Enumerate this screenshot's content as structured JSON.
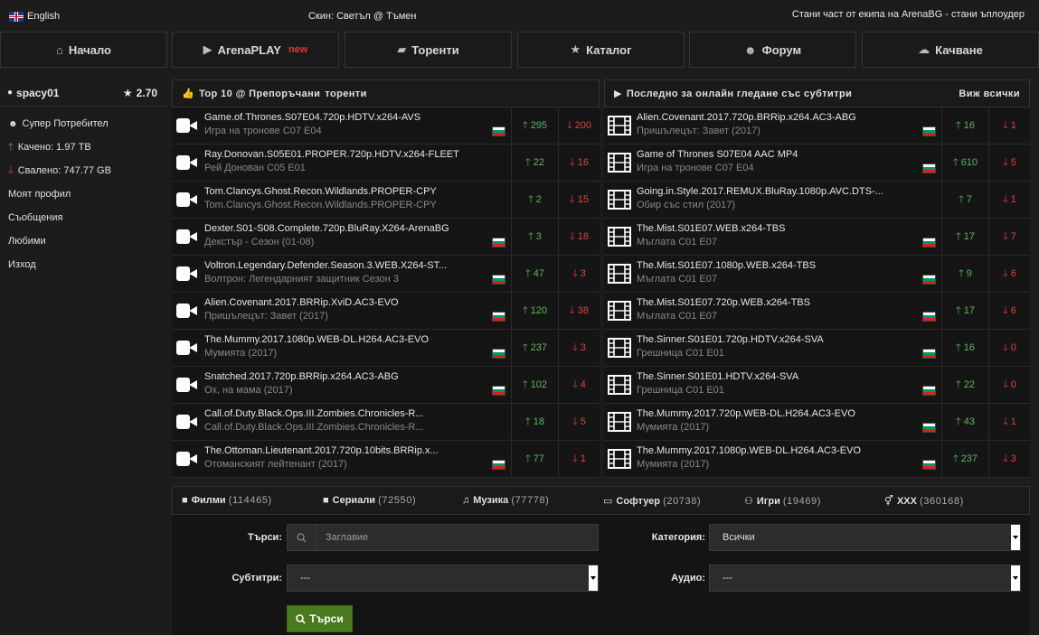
{
  "top": {
    "language": "English",
    "skin": "Скин: Светъл @ Тъмен",
    "uploader": "Стани част от екипа на ArenaBG - стани ъплоудер"
  },
  "nav": [
    {
      "label": "Начало",
      "icon": "home-icon",
      "glyph": "⌂"
    },
    {
      "label": "ArenaPLAY",
      "icon": "play-icon",
      "glyph": "▶",
      "badge": "new"
    },
    {
      "label": "Торенти",
      "icon": "folder-icon",
      "glyph": "▰"
    },
    {
      "label": "Каталог",
      "icon": "star-icon",
      "glyph": "★"
    },
    {
      "label": "Форум",
      "icon": "users-icon",
      "glyph": "☻"
    },
    {
      "label": "Качване",
      "icon": "cloud-upload-icon",
      "glyph": "☁"
    }
  ],
  "sidebar": {
    "username": "spacy01",
    "rating": "2.70",
    "items": [
      {
        "label": "Супер Потребител",
        "icon": "users-icon"
      },
      {
        "label": "Качено: 1.97 TB",
        "icon": "arrow-up-icon"
      },
      {
        "label": "Свалено: 747.77 GB",
        "icon": "arrow-down-icon"
      },
      {
        "label": "Моят профил"
      },
      {
        "label": "Съобщения"
      },
      {
        "label": "Любими"
      },
      {
        "label": "Изход"
      }
    ]
  },
  "top10": {
    "title_prefix": "Top 10 @ Препоръчани",
    "title_bold": "торенти",
    "rows": [
      {
        "name": "Game.of.Thrones.S07E04.720p.HDTV.x264-AVS",
        "sub": "Игра на тронове С07 Е04",
        "seed": "295",
        "leech": "200",
        "flag": true
      },
      {
        "name": "Ray.Donovan.S05E01.PROPER.720p.HDTV.x264-FLEET",
        "sub": "Рей Донован С05 Е01",
        "seed": "22",
        "leech": "16",
        "flag": false
      },
      {
        "name": "Tom.Clancys.Ghost.Recon.Wildlands.PROPER-CPY",
        "sub": "Tom.Clancys.Ghost.Recon.Wildlands.PROPER-CPY",
        "seed": "2",
        "leech": "15",
        "flag": false
      },
      {
        "name": "Dexter.S01-S08.Complete.720p.BluRay.X264-ArenaBG",
        "sub": "Декстър - Сезон (01-08)",
        "seed": "3",
        "leech": "18",
        "flag": true
      },
      {
        "name": "Voltron.Legendary.Defender.Season.3.WEB.X264-ST...",
        "sub": "Волтрон: Легендарният защитник Сезон 3",
        "seed": "47",
        "leech": "3",
        "flag": true
      },
      {
        "name": "Alien.Covenant.2017.BRRip.XviD.AC3-EVO",
        "sub": "Пришълецът: Завет (2017)",
        "seed": "120",
        "leech": "38",
        "flag": true
      },
      {
        "name": "The.Mummy.2017.1080p.WEB-DL.H264.AC3-EVO",
        "sub": "Мумията (2017)",
        "seed": "237",
        "leech": "3",
        "flag": true
      },
      {
        "name": "Snatched.2017.720p.BRRip.x264.AC3-ABG",
        "sub": "Ох, на мама (2017)",
        "seed": "102",
        "leech": "4",
        "flag": true
      },
      {
        "name": "Call.of.Duty.Black.Ops.III.Zombies.Chronicles-R...",
        "sub": "Call.of.Duty.Black.Ops.III.Zombies.Chronicles-R...",
        "seed": "18",
        "leech": "5",
        "flag": false
      },
      {
        "name": "The.Ottoman.Lieutenant.2017.720p.10bits.BRRip.x...",
        "sub": "Отоманският лейтенант (2017)",
        "seed": "77",
        "leech": "1",
        "flag": true
      }
    ]
  },
  "online": {
    "title": "Последно за онлайн гледане със субтитри",
    "view_all": "Виж всички",
    "rows": [
      {
        "name": "Alien.Covenant.2017.720p.BRRip.x264.AC3-ABG",
        "sub": "Пришълецът: Завет (2017)",
        "seed": "16",
        "leech": "1",
        "flag": true
      },
      {
        "name": "Game of Thrones S07E04 AAC MP4",
        "sub": "Игра на тронове С07 Е04",
        "seed": "610",
        "leech": "5",
        "flag": true
      },
      {
        "name": "Going.in.Style.2017.REMUX.BluRay.1080p.AVC.DTS-...",
        "sub": "Обир със стил (2017)",
        "seed": "7",
        "leech": "1",
        "flag": false
      },
      {
        "name": "The.Mist.S01E07.WEB.x264-TBS",
        "sub": "Мъглата С01 Е07",
        "seed": "17",
        "leech": "7",
        "flag": true
      },
      {
        "name": "The.Mist.S01E07.1080p.WEB.x264-TBS",
        "sub": "Мъглата С01 Е07",
        "seed": "9",
        "leech": "6",
        "flag": true
      },
      {
        "name": "The.Mist.S01E07.720p.WEB.x264-TBS",
        "sub": "Мъглата С01 Е07",
        "seed": "17",
        "leech": "6",
        "flag": true
      },
      {
        "name": "The.Sinner.S01E01.720p.HDTV.x264-SVA",
        "sub": "Грешница С01 Е01",
        "seed": "16",
        "leech": "0",
        "flag": true
      },
      {
        "name": "The.Sinner.S01E01.HDTV.x264-SVA",
        "sub": "Грешница С01 Е01",
        "seed": "22",
        "leech": "0",
        "flag": true
      },
      {
        "name": "The.Mummy.2017.720p.WEB-DL.H264.AC3-EVO",
        "sub": "Мумията (2017)",
        "seed": "43",
        "leech": "1",
        "flag": true
      },
      {
        "name": "The.Mummy.2017.1080p.WEB-DL.H264.AC3-EVO",
        "sub": "Мумията (2017)",
        "seed": "237",
        "leech": "3",
        "flag": true
      }
    ]
  },
  "categories": [
    {
      "label": "Филми",
      "count": "(114465)",
      "icon": "video-camera-icon",
      "glyph": "■"
    },
    {
      "label": "Сериали",
      "count": "(72550)",
      "icon": "tv-camera-icon",
      "glyph": "■"
    },
    {
      "label": "Музика",
      "count": "(77778)",
      "icon": "music-icon",
      "glyph": "♫"
    },
    {
      "label": "Софтуер",
      "count": "(20738)",
      "icon": "desktop-icon",
      "glyph": "▭"
    },
    {
      "label": "Игри",
      "count": "(19469)",
      "icon": "gamepad-icon",
      "glyph": "⚇"
    },
    {
      "label": "XXX",
      "count": "(360168)",
      "icon": "venus-mars-icon",
      "glyph": "⚥"
    }
  ],
  "search": {
    "search_label": "Търси:",
    "search_placeholder": "Заглавие",
    "category_label": "Категория:",
    "category_value": "Всички",
    "subtitles_label": "Субтитри:",
    "subtitles_value": "---",
    "audio_label": "Аудио:",
    "audio_value": "---",
    "button": "Търси"
  },
  "colors": {
    "seed": "#5cb85c",
    "leech": "#e0433b",
    "button": "#4a7a1e",
    "new_badge": "#e53935"
  }
}
